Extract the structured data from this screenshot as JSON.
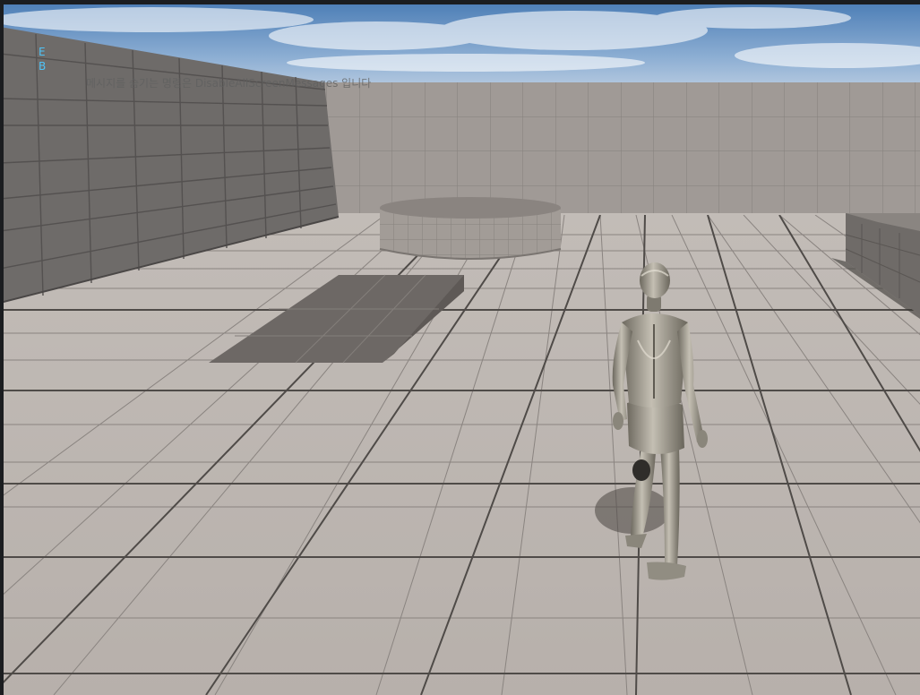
{
  "screen_messages": {
    "lines": [
      "E",
      "B"
    ],
    "hint": "메시지를 숨기는 명령은 DisableAllScreenMessages 입니다"
  },
  "colors": {
    "debug_text": "#4fc3f7",
    "frame": "#1b1d20",
    "sky_top": "#4d7fb8",
    "sky_bottom": "#c9d7e6",
    "floor": "#bcb5b0",
    "wall_left": "#6e6b69",
    "wall_back": "#9f9995",
    "ramp": "#6d6865",
    "mannequin": "#9c978c"
  },
  "scene": {
    "objects": [
      "left-wall",
      "back-wall",
      "cylinder-platform",
      "floor-ramp",
      "right-ramp-block",
      "mannequin-character"
    ]
  }
}
